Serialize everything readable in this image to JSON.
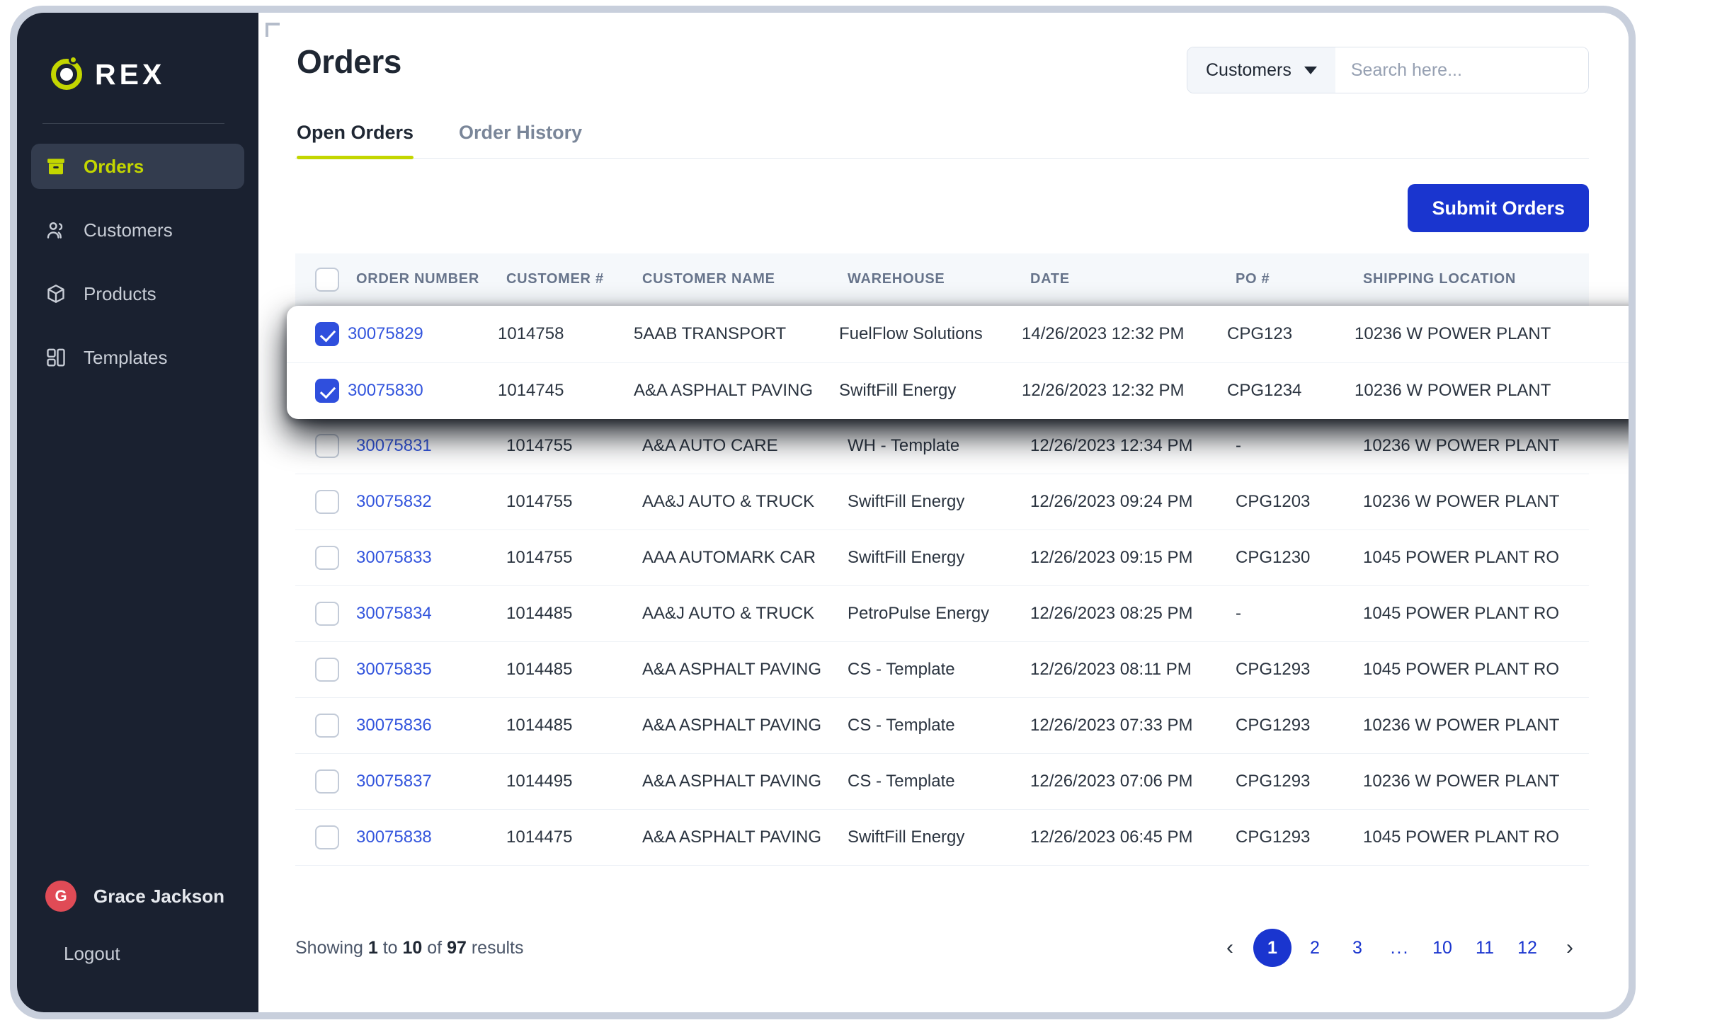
{
  "brand": {
    "name": "REX",
    "logo_icon": "rex-circle-icon"
  },
  "sidebar": {
    "items": [
      {
        "label": "Orders",
        "icon": "archive-box-icon",
        "active": true
      },
      {
        "label": "Customers",
        "icon": "users-icon",
        "active": false
      },
      {
        "label": "Products",
        "icon": "cube-icon",
        "active": false
      },
      {
        "label": "Templates",
        "icon": "layout-icon",
        "active": false
      }
    ],
    "user": {
      "name": "Grace Jackson",
      "initial": "G",
      "avatar_color": "#e04b56"
    },
    "logout": {
      "label": "Logout",
      "icon": "logout-icon"
    }
  },
  "header": {
    "title": "Orders"
  },
  "search": {
    "scope": "Customers",
    "scope_icon": "chevron-down-icon",
    "placeholder": "Search here...",
    "value": "",
    "icon": "search-icon"
  },
  "tabs": [
    {
      "label": "Open Orders",
      "active": true
    },
    {
      "label": "Order History",
      "active": false
    }
  ],
  "toolbar": {
    "submit_label": "Submit Orders",
    "submit_color": "#1a35cf"
  },
  "table": {
    "columns": [
      "ORDER NUMBER",
      "CUSTOMER #",
      "CUSTOMER NAME",
      "WAREHOUSE",
      "DATE",
      "PO #",
      "SHIPPING LOCATION"
    ],
    "header_checkbox_checked": false,
    "rows": [
      {
        "checked": true,
        "order": "30075829",
        "customer": "1014758",
        "name": "5AAB TRANSPORT",
        "warehouse": "FuelFlow Solutions",
        "date": "14/26/2023 12:32 PM",
        "po": "CPG123",
        "ship": "10236 W POWER PLANT"
      },
      {
        "checked": true,
        "order": "30075830",
        "customer": "1014745",
        "name": "A&A ASPHALT PAVING",
        "warehouse": "SwiftFill Energy",
        "date": "12/26/2023 12:32 PM",
        "po": "CPG1234",
        "ship": "10236 W POWER PLANT"
      },
      {
        "checked": false,
        "order": "30075831",
        "customer": "1014755",
        "name": "A&A AUTO CARE",
        "warehouse": "WH - Template",
        "date": "12/26/2023 12:34 PM",
        "po": "-",
        "ship": "10236 W POWER PLANT"
      },
      {
        "checked": false,
        "order": "30075832",
        "customer": "1014755",
        "name": "AA&J AUTO & TRUCK",
        "warehouse": "SwiftFill Energy",
        "date": "12/26/2023 09:24 PM",
        "po": "CPG1203",
        "ship": "10236 W POWER PLANT"
      },
      {
        "checked": false,
        "order": "30075833",
        "customer": "1014755",
        "name": "AAA AUTOMARK CAR",
        "warehouse": "SwiftFill Energy",
        "date": "12/26/2023 09:15 PM",
        "po": "CPG1230",
        "ship": "1045 POWER PLANT RO"
      },
      {
        "checked": false,
        "order": "30075834",
        "customer": "1014485",
        "name": "AA&J AUTO & TRUCK",
        "warehouse": "PetroPulse Energy",
        "date": "12/26/2023 08:25 PM",
        "po": "-",
        "ship": "1045 POWER PLANT RO"
      },
      {
        "checked": false,
        "order": "30075835",
        "customer": "1014485",
        "name": "A&A ASPHALT PAVING",
        "warehouse": "CS - Template",
        "date": "12/26/2023 08:11 PM",
        "po": "CPG1293",
        "ship": "1045 POWER PLANT RO"
      },
      {
        "checked": false,
        "order": "30075836",
        "customer": "1014485",
        "name": "A&A ASPHALT PAVING",
        "warehouse": "CS - Template",
        "date": "12/26/2023 07:33 PM",
        "po": "CPG1293",
        "ship": "10236 W POWER PLANT"
      },
      {
        "checked": false,
        "order": "30075837",
        "customer": "1014495",
        "name": "A&A ASPHALT PAVING",
        "warehouse": "CS - Template",
        "date": "12/26/2023 07:06 PM",
        "po": "CPG1293",
        "ship": "10236 W POWER PLANT"
      },
      {
        "checked": false,
        "order": "30075838",
        "customer": "1014475",
        "name": "A&A ASPHALT PAVING",
        "warehouse": "SwiftFill Energy",
        "date": "12/26/2023 06:45 PM",
        "po": "CPG1293",
        "ship": "1045 POWER PLANT RO"
      }
    ]
  },
  "footer": {
    "showing_prefix": "Showing ",
    "showing_from": "1",
    "showing_mid": " to ",
    "showing_to": "10",
    "showing_of": " of ",
    "showing_total": "97",
    "showing_suffix": " results",
    "pagination": {
      "prev_icon": "chevron-left-icon",
      "next_icon": "chevron-right-icon",
      "pages": [
        "1",
        "2",
        "3",
        "...",
        "10",
        "11",
        "12"
      ],
      "active": "1",
      "active_color": "#1a35cf"
    }
  },
  "cursor": {
    "icon": "pointer-hand-cursor"
  }
}
